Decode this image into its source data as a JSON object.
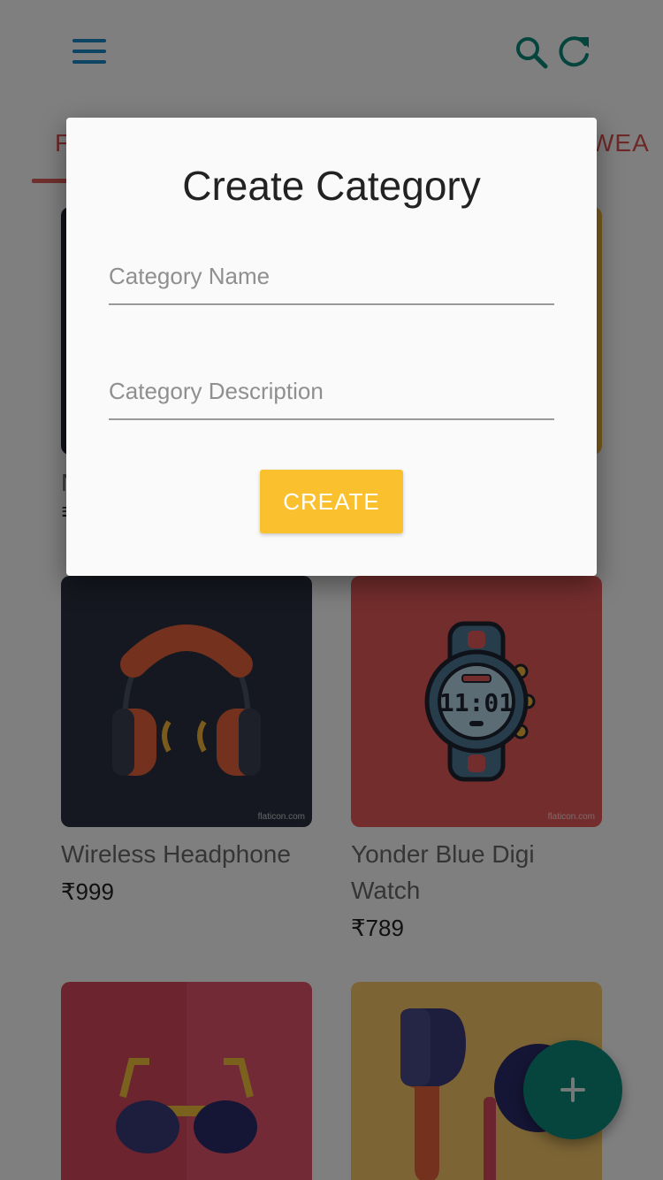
{
  "appbar": {
    "menu_icon": "menu-icon",
    "search_icon": "search-icon",
    "refresh_icon": "refresh-icon"
  },
  "tabs": {
    "left_partial": "F",
    "right_partial": "WEA"
  },
  "colors": {
    "primary": "#1a86c7",
    "accent": "#fbc02d",
    "fab": "#0a8a7a",
    "tab_text": "#d9534f"
  },
  "top_row": {
    "name_fragment": "N",
    "price_fragment": "₹"
  },
  "products": [
    {
      "name": "Wireless Headphone",
      "price": "₹999",
      "watermark": "flaticon.com",
      "icon": "headphone-image"
    },
    {
      "name": "Yonder Blue Digi Watch",
      "price": "₹789",
      "watermark": "flaticon.com",
      "icon": "watch-image",
      "watch_time": "11:01"
    },
    {
      "name": "",
      "price": "",
      "icon": "sunglasses-image"
    },
    {
      "name": "",
      "price": "",
      "icon": "earbud-image"
    }
  ],
  "fab": {
    "icon": "plus-icon"
  },
  "dialog": {
    "title": "Create Category",
    "name_placeholder": "Category Name",
    "description_placeholder": "Category Description",
    "create_label": "CREATE"
  }
}
